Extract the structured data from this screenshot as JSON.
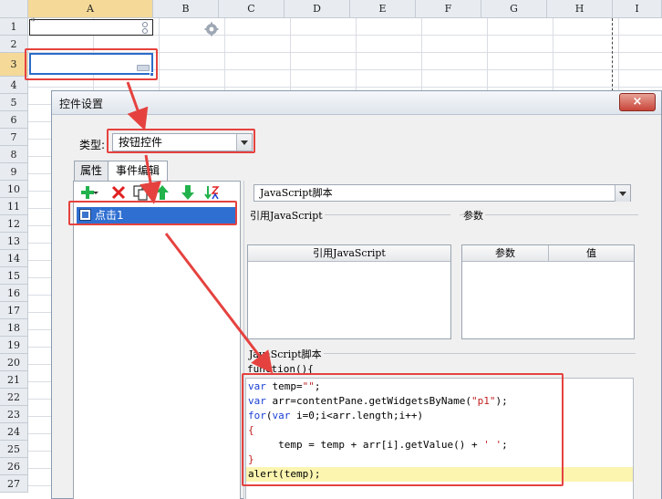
{
  "sheet": {
    "columns": [
      "A",
      "B",
      "C",
      "D",
      "E",
      "F",
      "G",
      "H",
      "I"
    ],
    "rows": [
      "1",
      "2",
      "3",
      "4",
      "5",
      "6",
      "7",
      "8",
      "9",
      "10",
      "11",
      "12",
      "13",
      "14",
      "15",
      "16",
      "17",
      "18",
      "19",
      "20",
      "21",
      "22",
      "23",
      "24",
      "25",
      "26",
      "27"
    ],
    "selected_column": "A",
    "selected_row": "3"
  },
  "dialog": {
    "title": "控件设置",
    "close_label": "×",
    "type_label": "类型:",
    "type_value": "按钮控件",
    "tabs": [
      {
        "label": "属性",
        "active": false
      },
      {
        "label": "事件编辑",
        "active": true
      }
    ],
    "event_item": "点击1",
    "script_type": "JavaScript脚本",
    "ref_js_label": "引用JavaScript",
    "params_label": "参数",
    "ref_js_table_header": "引用JavaScript",
    "params_table_headers": [
      "参数",
      "值"
    ],
    "script_section_label": "JavaScript脚本",
    "func_header": "function(){"
  },
  "colors": {
    "accent": "#2f6fd1",
    "highlight": "#e5423f",
    "add": "#22b24c",
    "delete": "#e02020"
  },
  "icons": [
    "add-icon",
    "delete-icon",
    "copy-icon",
    "move-up-icon",
    "move-down-icon",
    "sort-icon",
    "gear-icon"
  ]
}
